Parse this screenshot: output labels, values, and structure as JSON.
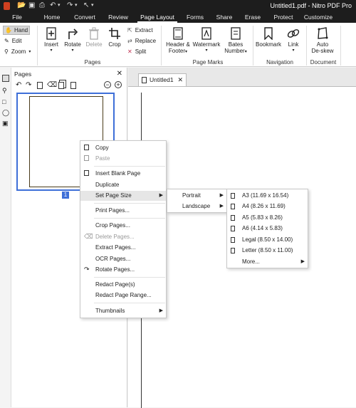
{
  "title_bar": {
    "title": "Untitled1.pdf - Nitro PDF Pro"
  },
  "menu_tabs": [
    "File",
    "Home",
    "Convert",
    "Review",
    "Page Layout",
    "Forms",
    "Share",
    "Erase",
    "Protect",
    "Customize"
  ],
  "ribbon": {
    "hand": "Hand",
    "edit": "Edit",
    "zoom": "Zoom",
    "insert": "Insert",
    "rotate": "Rotate",
    "delete": "Delete",
    "crop": "Crop",
    "extract": "Extract",
    "replace": "Replace",
    "split": "Split",
    "header_footer_1": "Header &",
    "header_footer_2": "Footer",
    "watermark": "Watermark",
    "bates_1": "Bates",
    "bates_2": "Number",
    "bookmark": "Bookmark",
    "link": "Link",
    "autodeskew_1": "Auto",
    "autodeskew_2": "De-skew",
    "groups": {
      "pages": "Pages",
      "page_marks": "Page Marks",
      "navigation": "Navigation",
      "document": "Document"
    }
  },
  "pages_panel": {
    "title": "Pages",
    "page_number": "1"
  },
  "doc_tab": {
    "label": "Untitled1"
  },
  "context_menu": {
    "items": [
      "Copy",
      "Paste",
      "Insert Blank Page",
      "Duplicate",
      "Set Page Size",
      "Print Pages...",
      "Crop Pages...",
      "Delete Pages...",
      "Extract Pages...",
      "OCR Pages...",
      "Rotate Pages...",
      "Redact Page(s)",
      "Redact Page Range...",
      "Thumbnails"
    ]
  },
  "orientation_menu": {
    "items": [
      "Portrait",
      "Landscape"
    ]
  },
  "size_menu": {
    "items": [
      "A3 (11.69 x 16.54)",
      "A4 (8.26 x 11.69)",
      "A5 (5.83 x 8.26)",
      "A6 (4.14 x 5.83)",
      "Legal (8.50 x 14.00)",
      "Letter (8.50 x 11.00)",
      "More..."
    ]
  },
  "colors": {
    "dark": "#1d1d1d",
    "accent": "#3e6fd8",
    "close_red": "#d04020"
  }
}
